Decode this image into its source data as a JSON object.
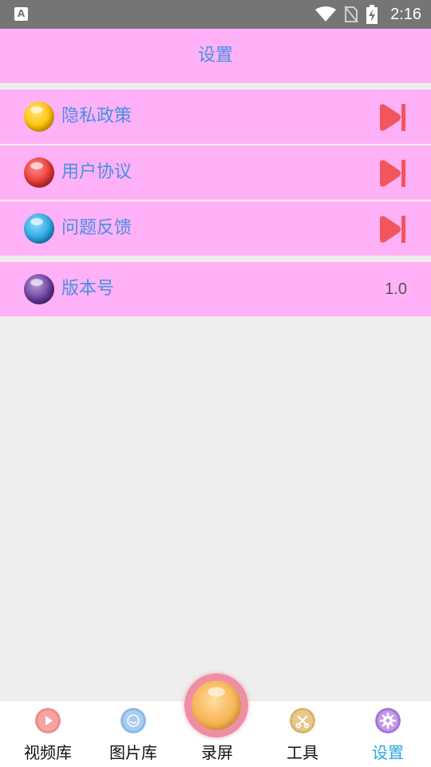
{
  "status_bar": {
    "time": "2:16",
    "notification_glyph": "A"
  },
  "header": {
    "title": "设置"
  },
  "settings": {
    "items": [
      {
        "label": "隐私政策",
        "ball_color": "#ffc107",
        "icon": "arrow-right-icon"
      },
      {
        "label": "用户协议",
        "ball_color": "#e53935",
        "icon": "arrow-right-icon"
      },
      {
        "label": "问题反馈",
        "ball_color": "#29a8e0",
        "icon": "arrow-right-icon"
      }
    ],
    "version": {
      "label": "版本号",
      "value": "1.0",
      "ball_color": "#6a3d9a"
    }
  },
  "bottom_nav": {
    "items": [
      {
        "label": "视频库",
        "icon": "video-library-icon",
        "color": "#f08a8a"
      },
      {
        "label": "图片库",
        "icon": "photo-library-icon",
        "color": "#8ab8e8"
      },
      {
        "label": "录屏",
        "icon": "record-button-icon",
        "color": "#f7b553"
      },
      {
        "label": "工具",
        "icon": "tools-icon",
        "color": "#d9b26a"
      },
      {
        "label": "设置",
        "icon": "settings-icon",
        "color": "#a574d6",
        "active": true
      }
    ]
  },
  "colors": {
    "accent_pink": "#ffb1f8",
    "text_blue": "#4a90e2",
    "arrow_red": "#f2555b",
    "active_tab": "#29a8e0"
  }
}
